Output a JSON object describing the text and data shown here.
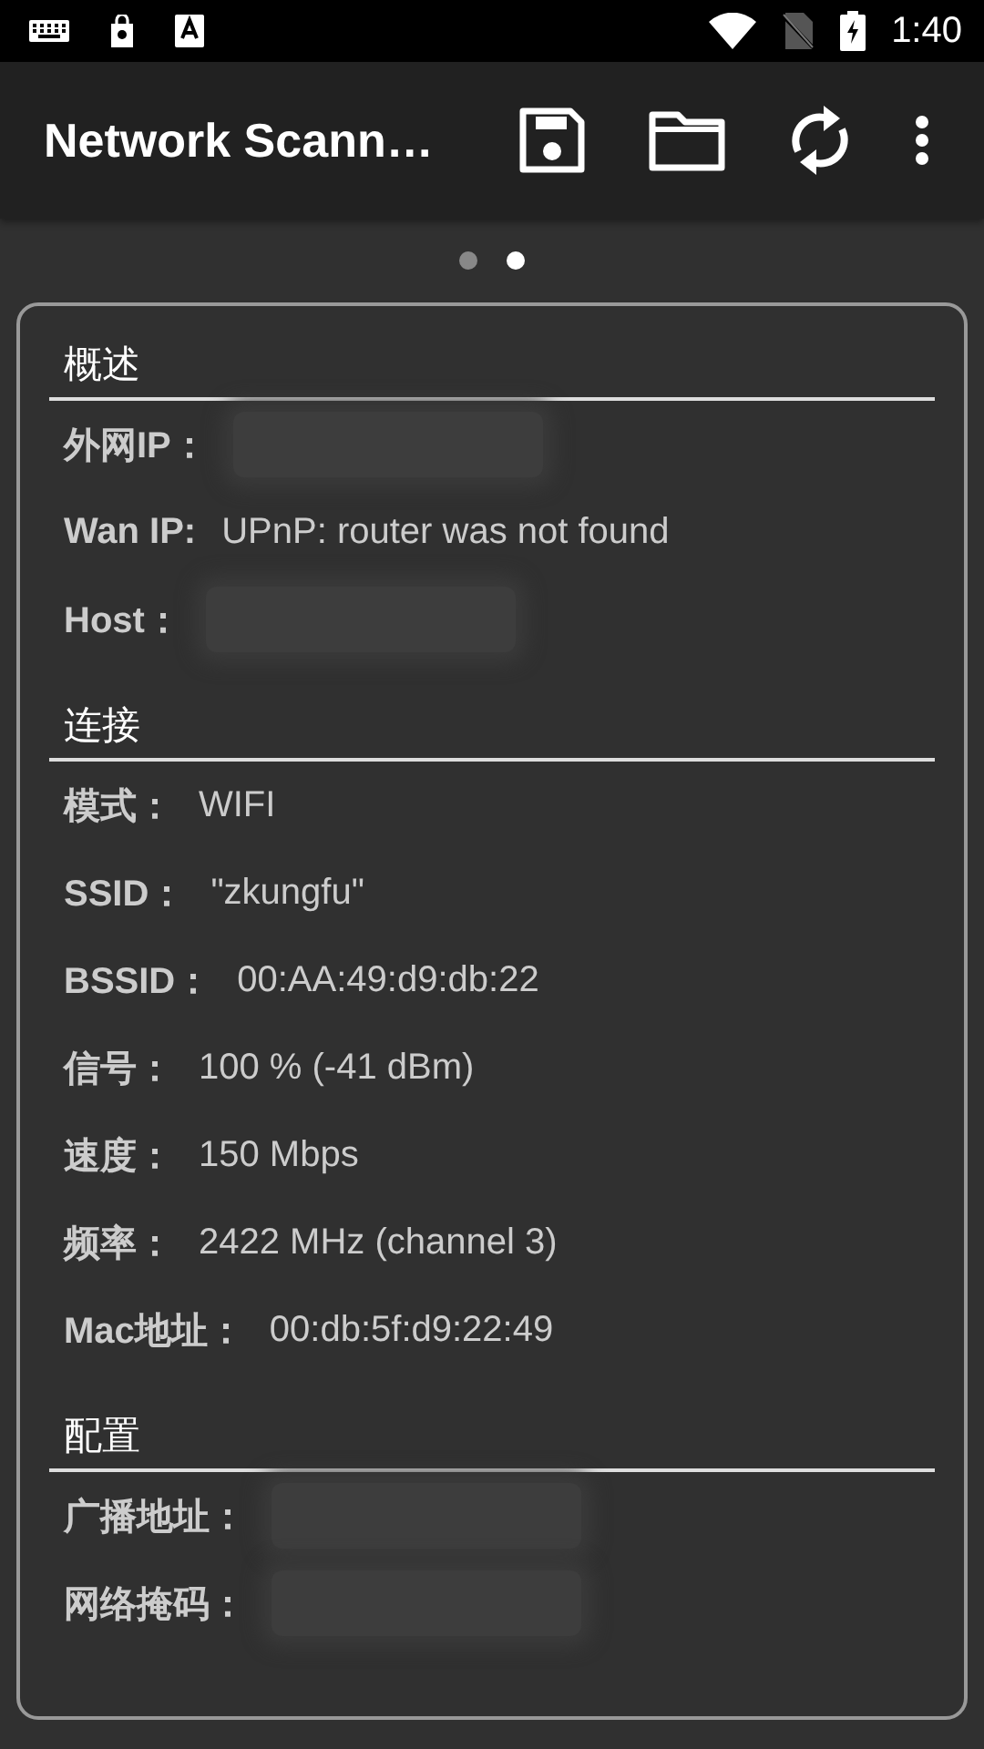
{
  "status_bar": {
    "time": "1:40"
  },
  "app_bar": {
    "title": "Network Scann…"
  },
  "pager": [
    {
      "selected": false
    },
    {
      "selected": true
    }
  ],
  "sections": [
    {
      "title": "概述",
      "rows": [
        {
          "label": "外网IP：",
          "kind": "redacted"
        },
        {
          "label": "Wan IP:",
          "kind": "text",
          "value": "UPnP: router was not found"
        },
        {
          "label": "Host：",
          "kind": "redacted"
        }
      ]
    },
    {
      "title": "连接",
      "rows": [
        {
          "label": "模式：",
          "kind": "text",
          "value": "WIFI"
        },
        {
          "label": "SSID：",
          "kind": "text",
          "value": "\"zkungfu\""
        },
        {
          "label": "BSSID：",
          "kind": "text",
          "value": "00:AA:49:d9:db:22"
        },
        {
          "label": "信号：",
          "kind": "text",
          "value": "100 % (-41 dBm)"
        },
        {
          "label": "速度：",
          "kind": "text",
          "value": "150 Mbps"
        },
        {
          "label": "频率：",
          "kind": "text",
          "value": "2422 MHz (channel 3)"
        },
        {
          "label": "Mac地址：",
          "kind": "text",
          "value": "00:db:5f:d9:22:49"
        }
      ]
    },
    {
      "title": "配置",
      "rows": [
        {
          "label": "广播地址：",
          "kind": "redacted"
        },
        {
          "label": "网络掩码：",
          "kind": "redacted"
        }
      ]
    }
  ]
}
